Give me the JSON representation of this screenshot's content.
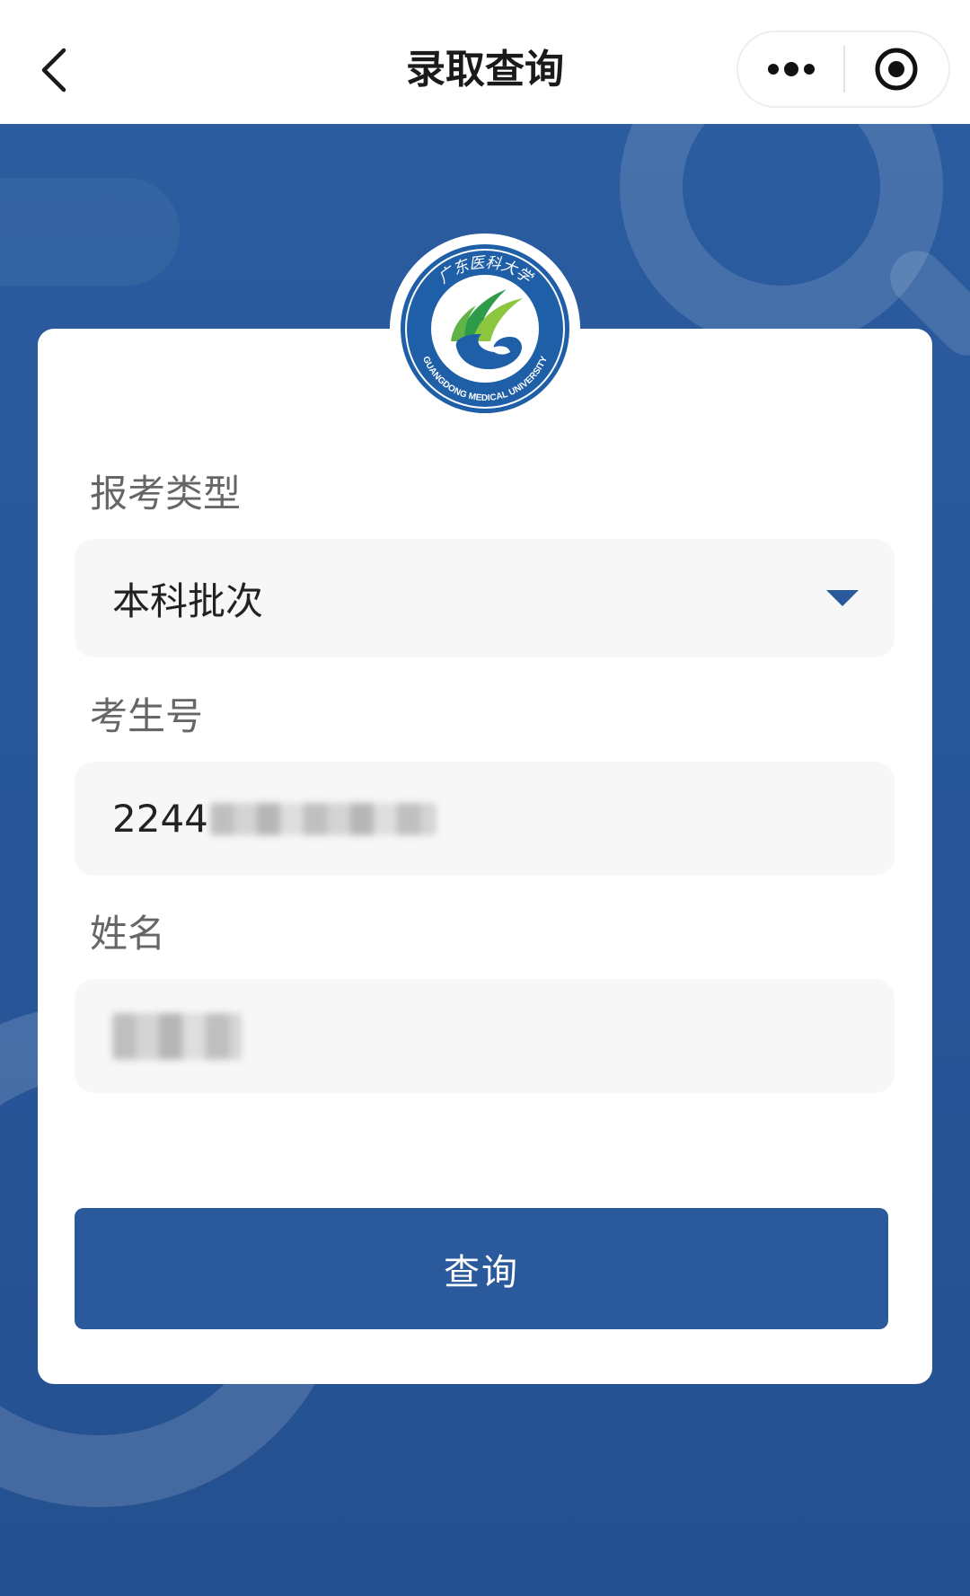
{
  "navbar": {
    "title": "录取查询"
  },
  "logo": {
    "text_top": "广东医科大学",
    "text_bottom": "GUANGDONG MEDICAL UNIVERSITY"
  },
  "form": {
    "exam_type": {
      "label": "报考类型",
      "value": "本科批次"
    },
    "candidate_no": {
      "label": "考生号",
      "value_visible": "2244"
    },
    "name": {
      "label": "姓名"
    },
    "submit_label": "查询"
  },
  "colors": {
    "brand_blue": "#2a5a9c",
    "background_blue": "#275597",
    "card_white": "#ffffff",
    "input_bg": "#f7f7f7"
  },
  "icons": {
    "back": "chevron-left-icon",
    "more": "more-dots-icon",
    "close": "target-circle-icon",
    "dropdown": "triangle-down-icon"
  }
}
